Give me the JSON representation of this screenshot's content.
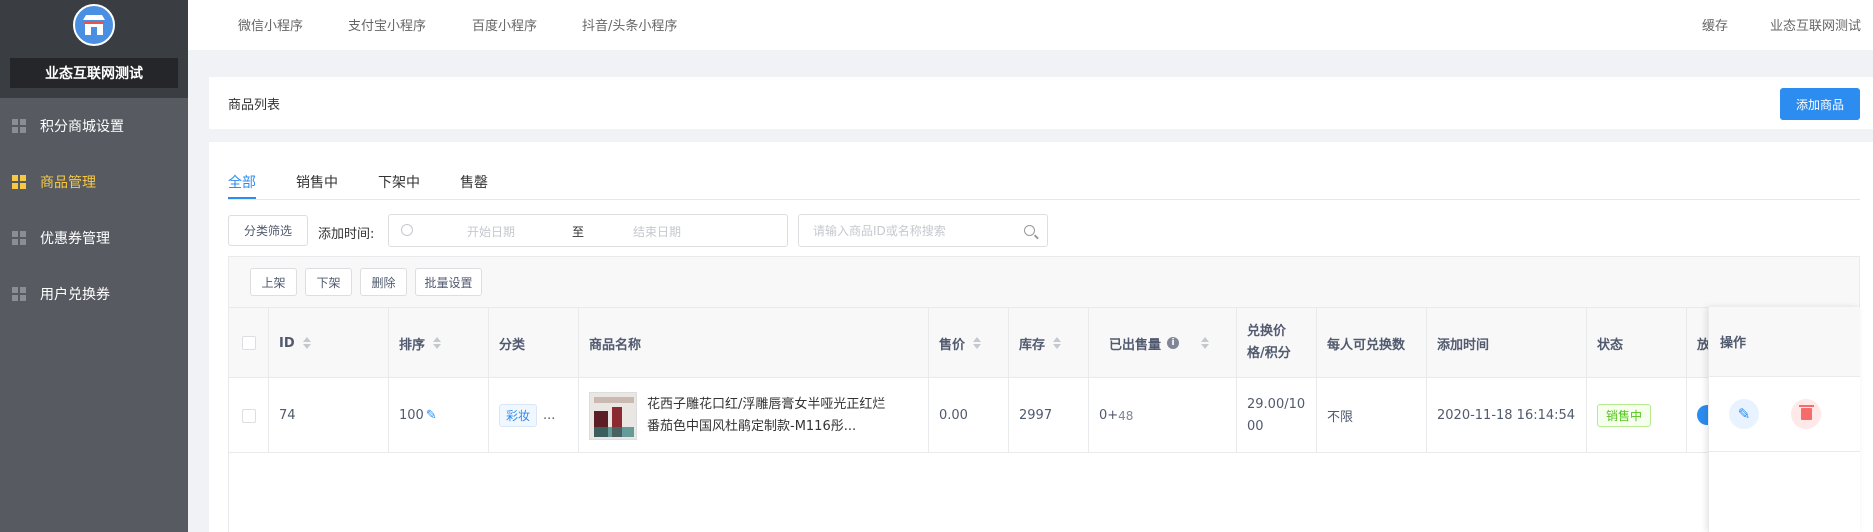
{
  "brand": {
    "name": "业态互联网测试",
    "logo_icon": "store-icon"
  },
  "sidebar": {
    "items": [
      {
        "label": "积分商城设置",
        "active": false
      },
      {
        "label": "商品管理",
        "active": true
      },
      {
        "label": "优惠券管理",
        "active": false
      },
      {
        "label": "用户兑换券",
        "active": false
      }
    ]
  },
  "topbar": {
    "links": [
      "微信小程序",
      "支付宝小程序",
      "百度小程序",
      "抖音/头条小程序"
    ],
    "cache": "缓存",
    "user": "业态互联网测试"
  },
  "page": {
    "title": "商品列表",
    "add_button": "添加商品"
  },
  "tabs": [
    {
      "label": "全部",
      "active": true
    },
    {
      "label": "销售中",
      "active": false
    },
    {
      "label": "下架中",
      "active": false
    },
    {
      "label": "售罄",
      "active": false
    }
  ],
  "filters": {
    "category_button": "分类筛选",
    "date_label": "添加时间:",
    "start_placeholder": "开始日期",
    "separator": "至",
    "end_placeholder": "结束日期",
    "search_placeholder": "请输入商品ID或名称搜索"
  },
  "toolbar": {
    "up": "上架",
    "down": "下架",
    "delete": "删除",
    "batch": "批量设置"
  },
  "table": {
    "headers": {
      "id": "ID",
      "sort": "排序",
      "category": "分类",
      "name": "商品名称",
      "price": "售价",
      "stock": "库存",
      "sold": "已出售量",
      "exchange_price_line1": "兑换价",
      "exchange_price_line2": "格/积分",
      "limit": "每人可兑换数",
      "time": "添加时间",
      "status": "状态",
      "partial": "放",
      "action": "操作"
    },
    "rows": [
      {
        "id": "74",
        "sort": "100",
        "category": "彩妆",
        "category_more": "...",
        "name": "花西子雕花口红/浮雕唇膏女半哑光正红烂番茄色中国风杜鹃定制款-M116彤...",
        "price": "0.00",
        "stock": "2997",
        "sold_base": "0+",
        "sold_extra": "48",
        "exchange_line1": "29.00/10",
        "exchange_line2": "00",
        "limit": "不限",
        "time": "2020-11-18 16:14:54",
        "status": "销售中"
      }
    ]
  },
  "colors": {
    "accent": "#2d8cf0",
    "sidebar": "#575b61",
    "active_menu": "#f7c842",
    "status_green": "#52c41a",
    "danger": "#f56c6c"
  }
}
